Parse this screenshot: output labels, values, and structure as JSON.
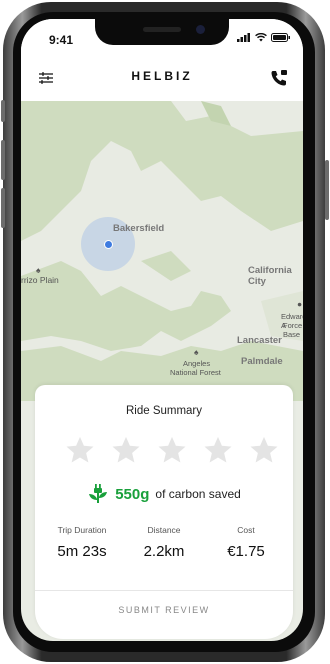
{
  "status_bar": {
    "time": "9:41"
  },
  "header": {
    "brand": "HELBIZ",
    "menu_icon": "menu-filter-icon",
    "call_icon": "phone-call-icon"
  },
  "map": {
    "labels": {
      "bakersfield": "Bakersfield",
      "carrizo_plain": "rrizo Plain",
      "california_city": "California City",
      "edwards": "Edwards A",
      "force_base": "Force Base",
      "lancaster": "Lancaster",
      "palmdale": "Palmdale",
      "angeles": "Angeles",
      "national_forest": "National Forest"
    }
  },
  "summary": {
    "title": "Ride Summary",
    "rating_stars": 5,
    "carbon_value": "550g",
    "carbon_text": "of carbon saved",
    "stats": {
      "trip_duration_label": "Trip Duration",
      "trip_duration_value": "5m 23s",
      "distance_label": "Distance",
      "distance_value": "2.2km",
      "cost_label": "Cost",
      "cost_value": "€1.75"
    },
    "submit_label": "SUBMIT REVIEW"
  },
  "colors": {
    "carbon_green": "#19a03b",
    "map_green": "#cfdcbf",
    "location_blue": "#3e7be0"
  }
}
